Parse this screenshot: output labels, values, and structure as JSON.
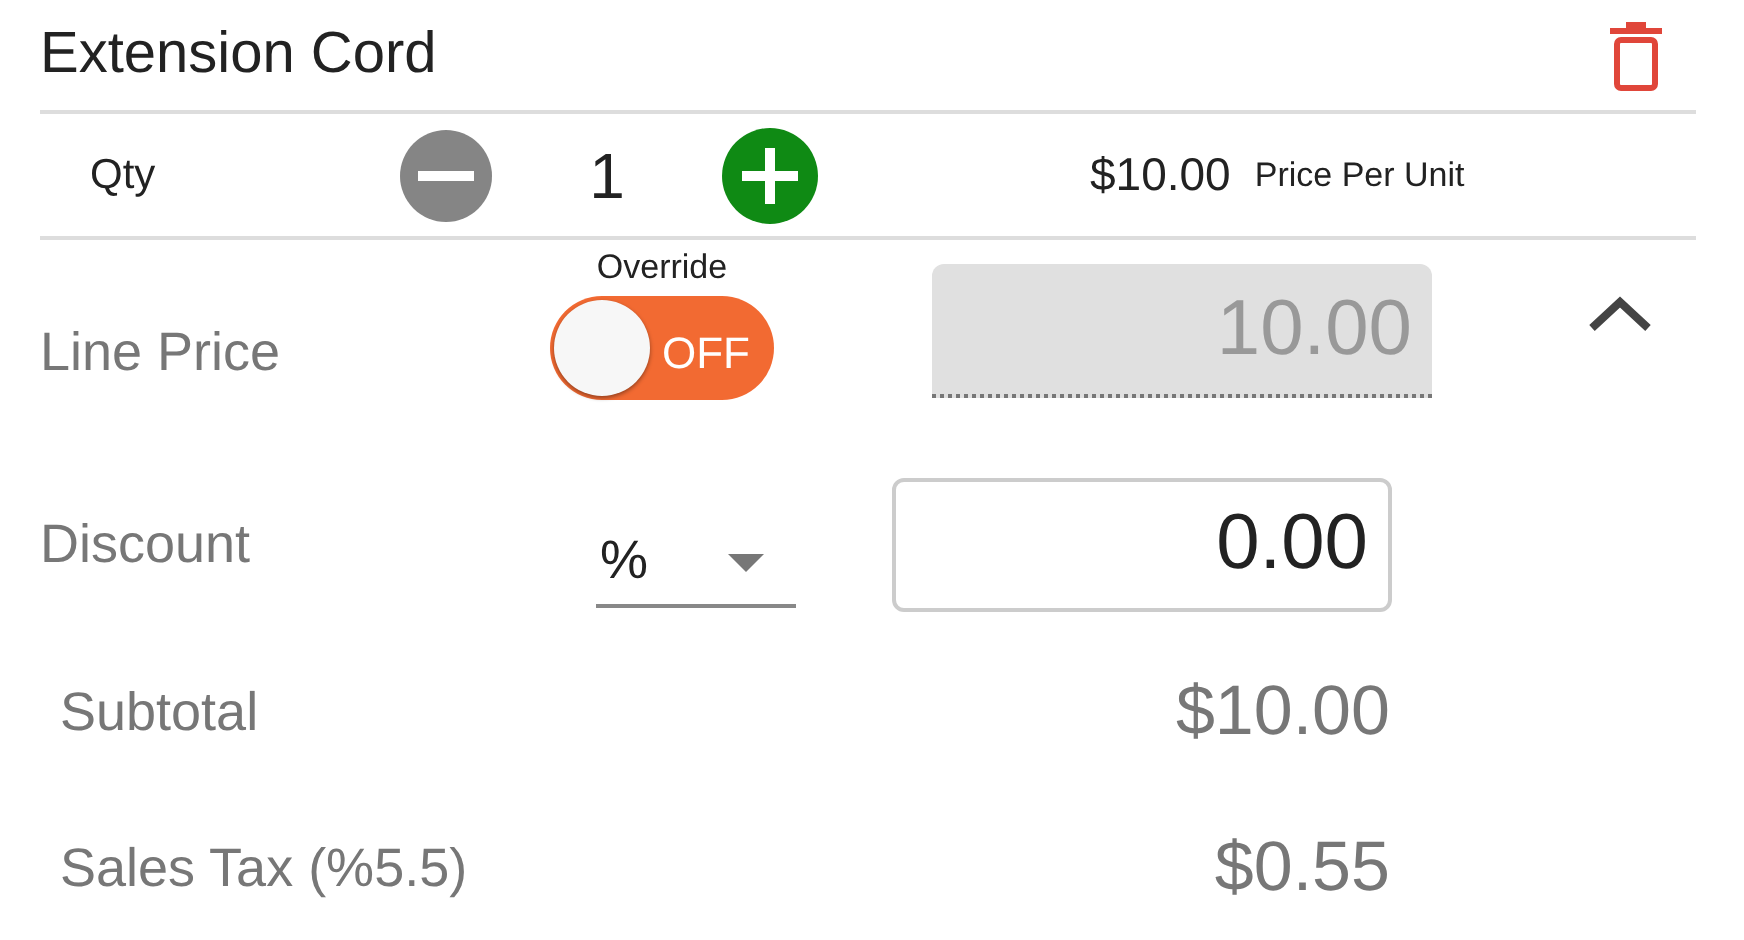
{
  "item": {
    "title": "Extension Cord"
  },
  "quantity": {
    "label": "Qty",
    "value": "1",
    "unit_price": "$10.00",
    "unit_price_label": "Price Per Unit"
  },
  "line_price": {
    "label": "Line Price",
    "override_label": "Override",
    "override": {
      "on": false,
      "text": "OFF"
    },
    "value": "10.00",
    "disabled": true
  },
  "details_expanded": true,
  "discount": {
    "label": "Discount",
    "type": "%",
    "value": "0.00"
  },
  "totals": [
    {
      "label": "Subtotal",
      "value": "$10.00"
    },
    {
      "label": "Sales Tax (%5.5)",
      "value": "$0.55"
    }
  ]
}
